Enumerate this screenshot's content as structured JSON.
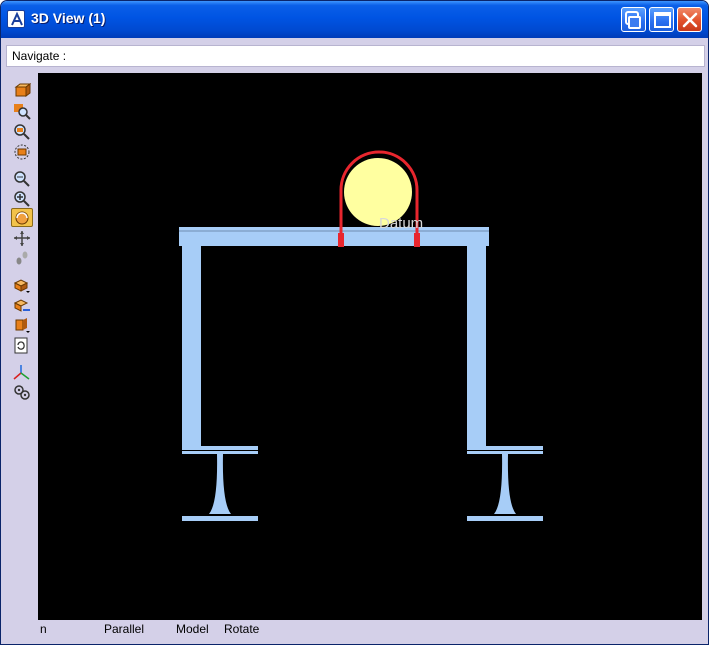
{
  "window": {
    "title": "3D View (1)",
    "buttons": [
      "minimize-button",
      "maximize-button",
      "close-button"
    ]
  },
  "navigate": {
    "label": "Navigate :"
  },
  "toolbar": {
    "tools": [
      {
        "name": "view-tool-icon",
        "active": false
      },
      {
        "name": "zoom-area-icon",
        "active": false
      },
      {
        "name": "zoom-previous-icon",
        "active": false
      },
      {
        "name": "fit-all-icon",
        "active": false
      },
      {
        "name": "zoom-search-icon",
        "active": false
      },
      {
        "name": "zoom-in-icon",
        "active": false
      },
      {
        "name": "rotate-view-icon",
        "active": true
      },
      {
        "name": "pan-icon",
        "active": false
      },
      {
        "name": "walk-icon",
        "active": false
      },
      {
        "name": "render-mode-icon",
        "active": false
      },
      {
        "name": "cut-section-icon",
        "active": false
      },
      {
        "name": "clip-plane-icon",
        "active": false
      },
      {
        "name": "refresh-icon",
        "active": false
      },
      {
        "name": "axes-icon",
        "active": false
      },
      {
        "name": "settings-gear-icon",
        "active": false
      }
    ]
  },
  "viewport": {
    "background": "#000000",
    "beam_color": "#a7cdf7",
    "pipe_color": "#ffffa0",
    "clamp_color": "#e8262e",
    "label": "Datum"
  },
  "status": {
    "mode": "n",
    "projection": "Parallel",
    "space": "Model",
    "action": "Rotate"
  }
}
